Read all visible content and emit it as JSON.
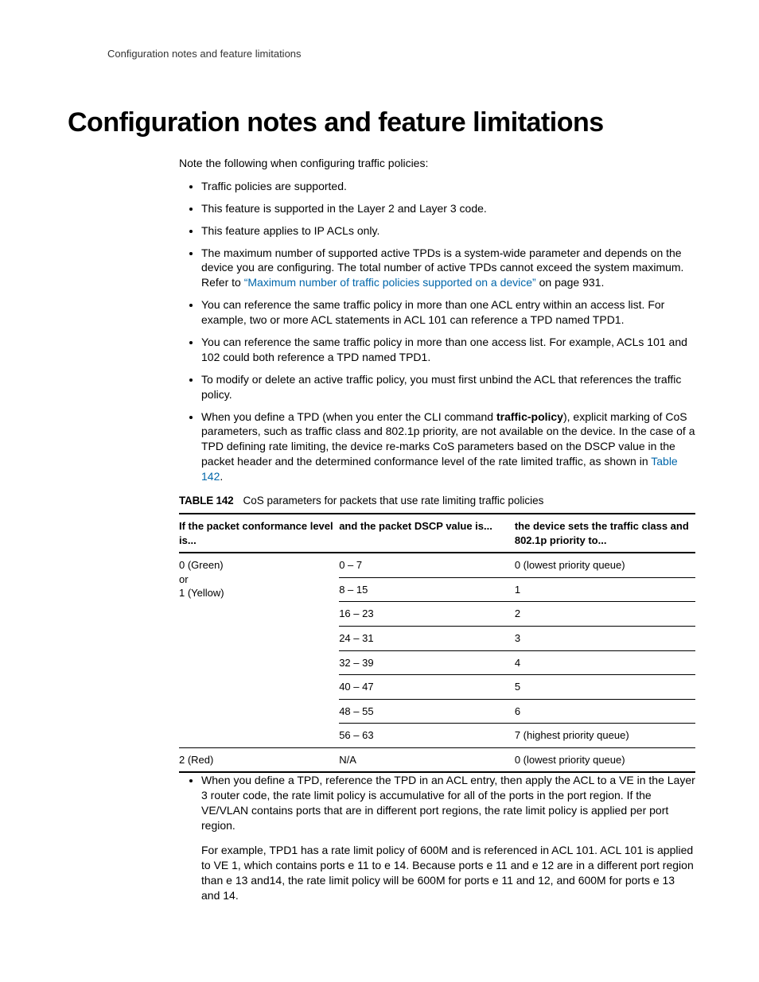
{
  "runningHeader": "Configuration notes and feature limitations",
  "h1": "Configuration notes and feature limitations",
  "intro": "Note the following when configuring traffic policies:",
  "bullets": {
    "b1": "Traffic policies are supported.",
    "b2": "This feature is supported in the Layer 2 and Layer 3 code.",
    "b3": "This feature applies to IP ACLs only.",
    "b4a": "The maximum number of supported active TPDs is a system-wide parameter and depends on the device you are configuring.  The total number of active TPDs cannot exceed the system maximum.  Refer to ",
    "b4link": "“Maximum number of traffic policies supported on a device”",
    "b4b": " on page 931.",
    "b5": "You can reference the same traffic policy in more than one ACL entry within an access list. For example, two or more ACL statements in ACL 101 can reference a TPD named TPD1.",
    "b6": "You can reference the same traffic policy in more than one access list. For example, ACLs 101 and 102 could both reference a TPD named TPD1.",
    "b7": "To modify or delete an active traffic policy, you must first unbind the ACL that references the traffic policy.",
    "b8a": "When you define a TPD (when you enter the CLI command ",
    "b8bold": "traffic-policy",
    "b8b": "), explicit marking of CoS parameters, such as traffic class and 802.1p priority, are not available on the device.  In the case of a TPD defining rate limiting, the device re-marks CoS parameters based on the DSCP value in the packet header and the determined conformance level of the rate limited traffic, as shown in ",
    "b8link": "Table 142",
    "b8c": "."
  },
  "tableLabel": "TABLE 142",
  "tableCaption": "CoS parameters for packets that use rate limiting traffic policies",
  "table": {
    "head": {
      "c1": "If the packet conformance level is...",
      "c2": "and the packet DSCP value is...",
      "c3": "the device sets the traffic class and 802.1p priority to..."
    },
    "rows": {
      "r1c1a": "0 (Green)",
      "r1c1b": "or",
      "r1c1c": "1 (Yellow)",
      "r1c2": "0 – 7",
      "r1c3": "0 (lowest priority queue)",
      "r2c2": "8 – 15",
      "r2c3": "1",
      "r3c2": "16 – 23",
      "r3c3": "2",
      "r4c2": "24 – 31",
      "r4c3": "3",
      "r5c2": "32 – 39",
      "r5c3": "4",
      "r6c2": "40 – 47",
      "r6c3": "5",
      "r7c2": "48 – 55",
      "r7c3": "6",
      "r8c2": "56 – 63",
      "r8c3": "7 (highest priority queue)",
      "r9c1": "2 (Red)",
      "r9c2": "N/A",
      "r9c3": "0 (lowest priority queue)"
    }
  },
  "afterBullet": "When you define a TPD, reference the TPD in an ACL entry, then apply the ACL to a VE in the Layer 3 router code, the rate limit policy is accumulative for all of the ports in the port region.  If the VE/VLAN contains ports that are in different port regions, the rate limit policy is applied per port region.",
  "examplePara": "For example, TPD1 has a rate limit policy of 600M and is referenced in ACL 101.  ACL 101 is applied to VE 1,  which contains ports e 11 to e 14.  Because ports e 11 and e 12 are in a different port region than e 13 and14, the rate limit policy will be 600M for ports e 11 and 12, and 600M for ports e 13 and 14."
}
